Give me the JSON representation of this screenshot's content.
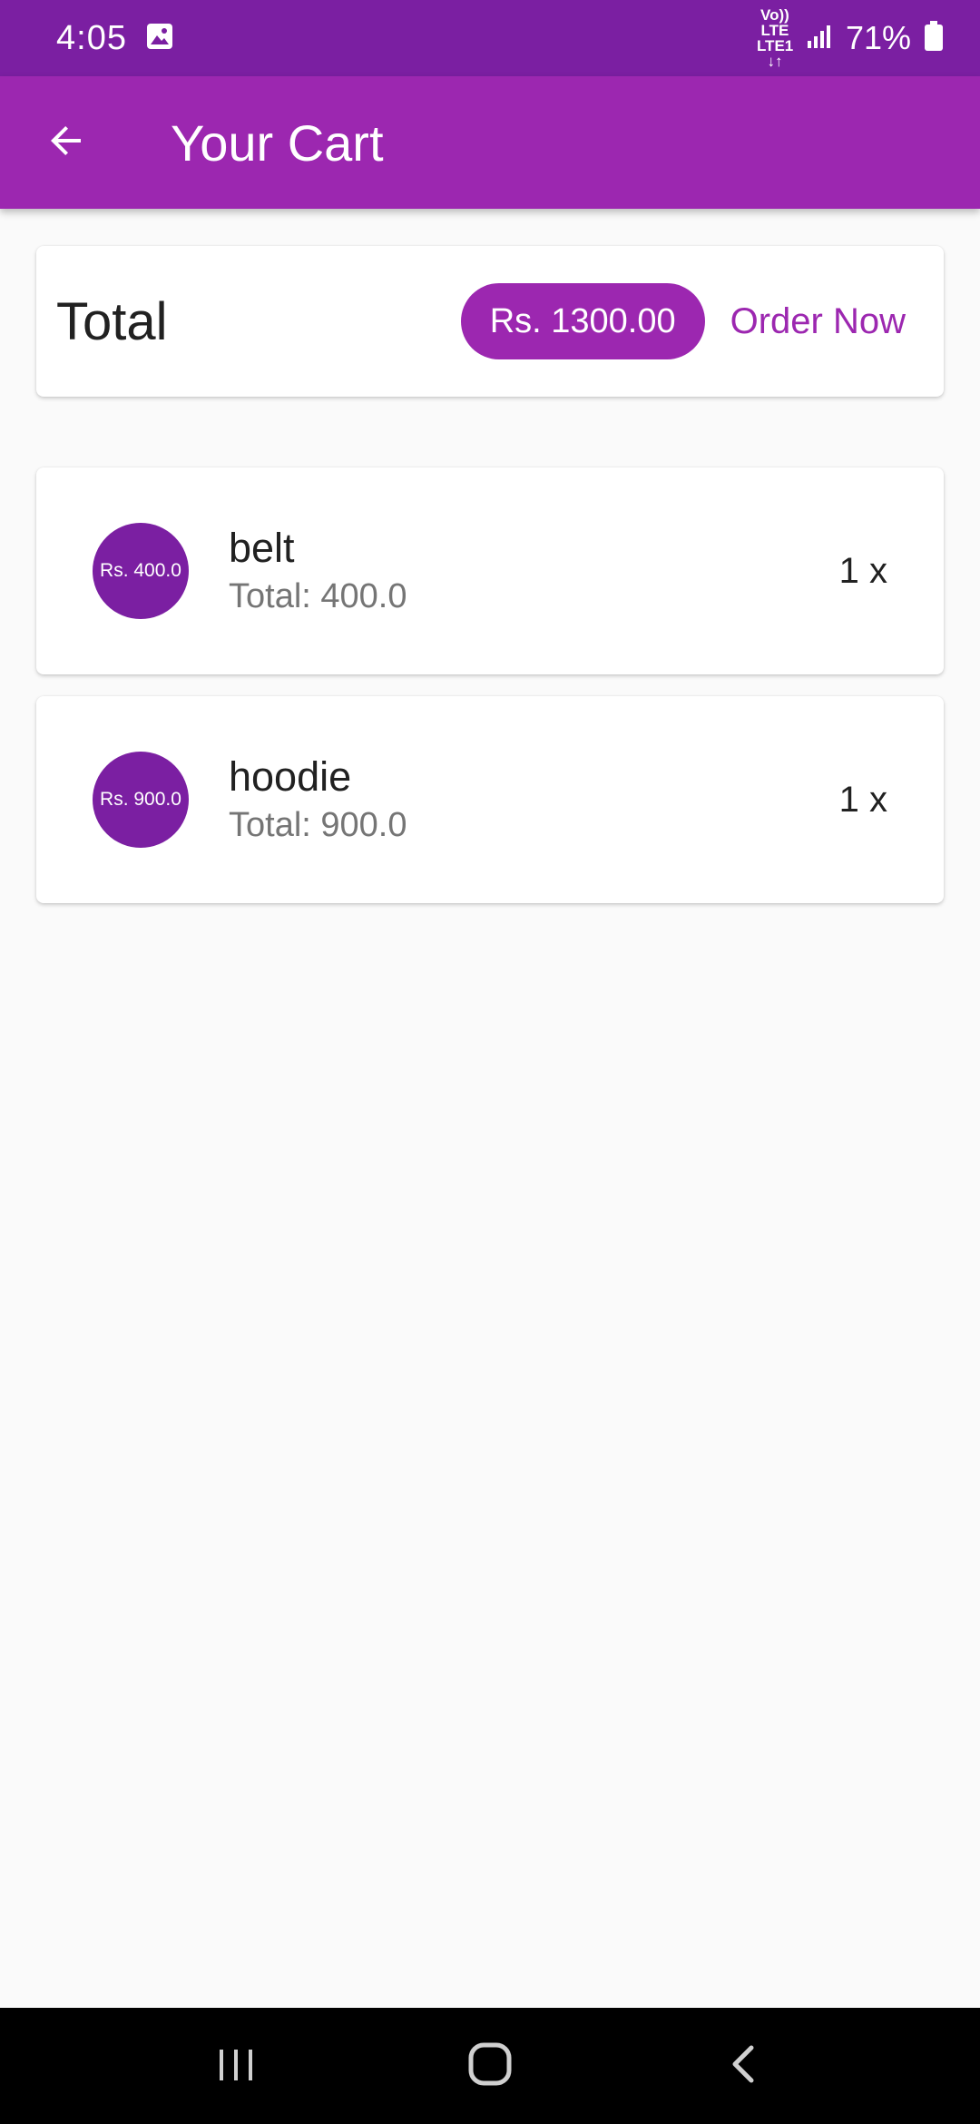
{
  "status_bar": {
    "time": "4:05",
    "net_top": "Vo)) LTE",
    "net_bottom": "LTE1 ↓↑",
    "battery": "71%"
  },
  "app_bar": {
    "title": "Your Cart"
  },
  "summary": {
    "total_label": "Total",
    "total_amount": "Rs. 1300.00",
    "order_button": "Order Now"
  },
  "items": [
    {
      "avatar_price": "Rs. 400.0",
      "name": "belt",
      "total": "Total: 400.0",
      "quantity": "1 x"
    },
    {
      "avatar_price": "Rs. 900.0",
      "name": "hoodie",
      "total": "Total: 900.0",
      "quantity": "1 x"
    }
  ],
  "colors": {
    "primary": "#9c27b0",
    "primary_dark": "#7b1fa2",
    "background": "#fafafa",
    "nav_bar": "#000000"
  },
  "icons": {
    "status": [
      "image-icon",
      "signal-icon",
      "battery-icon"
    ],
    "app_bar": "back-arrow-icon",
    "nav": [
      "recent-apps-icon",
      "home-icon",
      "back-icon"
    ]
  }
}
